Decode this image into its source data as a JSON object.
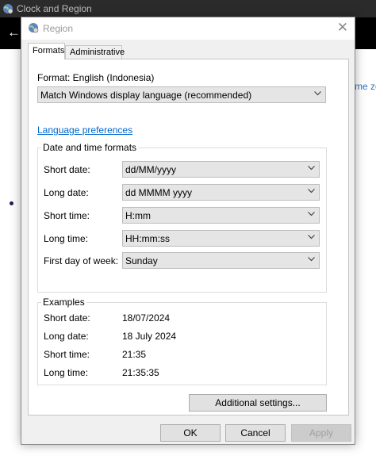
{
  "background_window": {
    "title": "Clock and Region",
    "back_glyph": "←",
    "partial_link": "me ze"
  },
  "dialog": {
    "title": "Region",
    "close_glyph": "✕",
    "tabs": [
      {
        "label": "Formats",
        "active": true
      },
      {
        "label": "Administrative",
        "active": false
      }
    ],
    "format_label": "Format: English (Indonesia)",
    "format_value": "Match Windows display language (recommended)",
    "language_link": "Language preferences",
    "date_time_group": {
      "title": "Date and time formats",
      "rows": [
        {
          "label": "Short date:",
          "value": "dd/MM/yyyy"
        },
        {
          "label": "Long date:",
          "value": "dd MMMM yyyy"
        },
        {
          "label": "Short time:",
          "value": "H:mm"
        },
        {
          "label": "Long time:",
          "value": "HH:mm:ss"
        },
        {
          "label": "First day of week:",
          "value": "Sunday"
        }
      ]
    },
    "examples_group": {
      "title": "Examples",
      "rows": [
        {
          "label": "Short date:",
          "value": "18/07/2024"
        },
        {
          "label": "Long date:",
          "value": "18 July 2024"
        },
        {
          "label": "Short time:",
          "value": "21:35"
        },
        {
          "label": "Long time:",
          "value": "21:35:35"
        }
      ]
    },
    "additional_settings_label": "Additional settings...",
    "ok_label": "OK",
    "cancel_label": "Cancel",
    "apply_label": "Apply"
  },
  "colors": {
    "link": "#0066cc",
    "dialog_bg": "#f0f0f0",
    "dark_header": "#000000"
  }
}
